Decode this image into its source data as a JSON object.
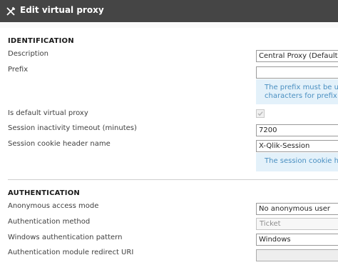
{
  "dialog": {
    "title": "Edit virtual proxy"
  },
  "identification": {
    "heading": "IDENTIFICATION",
    "description_label": "Description",
    "description_value": "Central Proxy (Default)",
    "prefix_label": "Prefix",
    "prefix_value": "",
    "prefix_hint_line1": "The prefix must be uni",
    "prefix_hint_line2": "characters for prefix ar",
    "default_label": "Is default virtual proxy",
    "default_checked": true,
    "timeout_label": "Session inactivity timeout (minutes)",
    "timeout_value": "7200",
    "cookie_label": "Session cookie header name",
    "cookie_value": "X-Qlik-Session",
    "cookie_hint": "The session cookie hea"
  },
  "authentication": {
    "heading": "AUTHENTICATION",
    "anon_label": "Anonymous access mode",
    "anon_value": "No anonymous user",
    "method_label": "Authentication method",
    "method_value": "Ticket",
    "windows_label": "Windows authentication pattern",
    "windows_value": "Windows",
    "redirect_label": "Authentication module redirect URI",
    "redirect_value": ""
  },
  "colors": {
    "titlebar": "#454545",
    "hint_background": "#e3f1fa",
    "hint_text": "#4a8fc1"
  }
}
